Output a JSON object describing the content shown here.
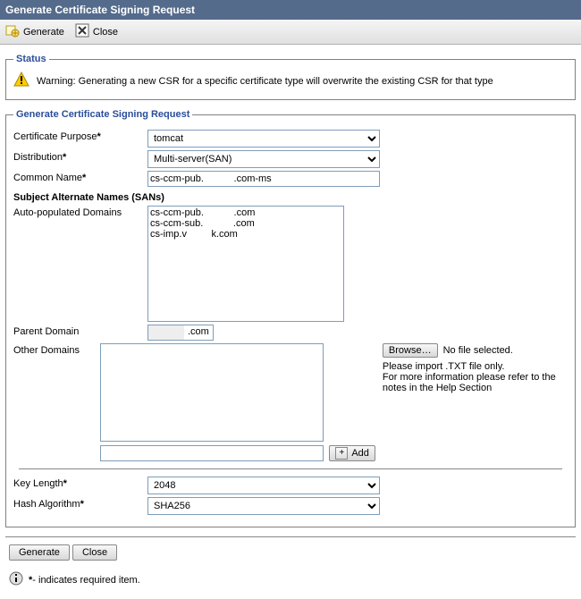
{
  "title": "Generate Certificate Signing Request",
  "toolbar": {
    "generate": "Generate",
    "close": "Close"
  },
  "status": {
    "legend": "Status",
    "warning": "Warning: Generating a new CSR for a specific certificate type will overwrite the existing CSR for that type"
  },
  "form": {
    "legend": "Generate Certificate Signing Request",
    "certPurpose": {
      "label": "Certificate Purpose",
      "value": "tomcat"
    },
    "distribution": {
      "label": "Distribution",
      "value": "Multi-server(SAN)"
    },
    "commonName": {
      "label": "Common Name",
      "value": "cs-ccm-pub.           .com-ms"
    },
    "san": {
      "heading": "Subject Alternate Names (SANs)",
      "autoLabel": "Auto-populated Domains",
      "autoValue": "cs-ccm-pub.           .com\ncs-ccm-sub.           .com\ncs-imp.v         k.com",
      "parentLabel": "Parent Domain",
      "parentSuffix": ".com",
      "otherLabel": "Other Domains",
      "browse": "Browse…",
      "noFile": "No file selected.",
      "help1": "Please import .TXT file only.",
      "help2": "For more information please refer to the notes in the Help Section",
      "addLabel": "Add"
    },
    "keyLength": {
      "label": "Key Length",
      "value": "2048"
    },
    "hashAlg": {
      "label": "Hash Algorithm",
      "value": "SHA256"
    }
  },
  "bottom": {
    "generate": "Generate",
    "close": "Close"
  },
  "footnote": "- indicates required item."
}
